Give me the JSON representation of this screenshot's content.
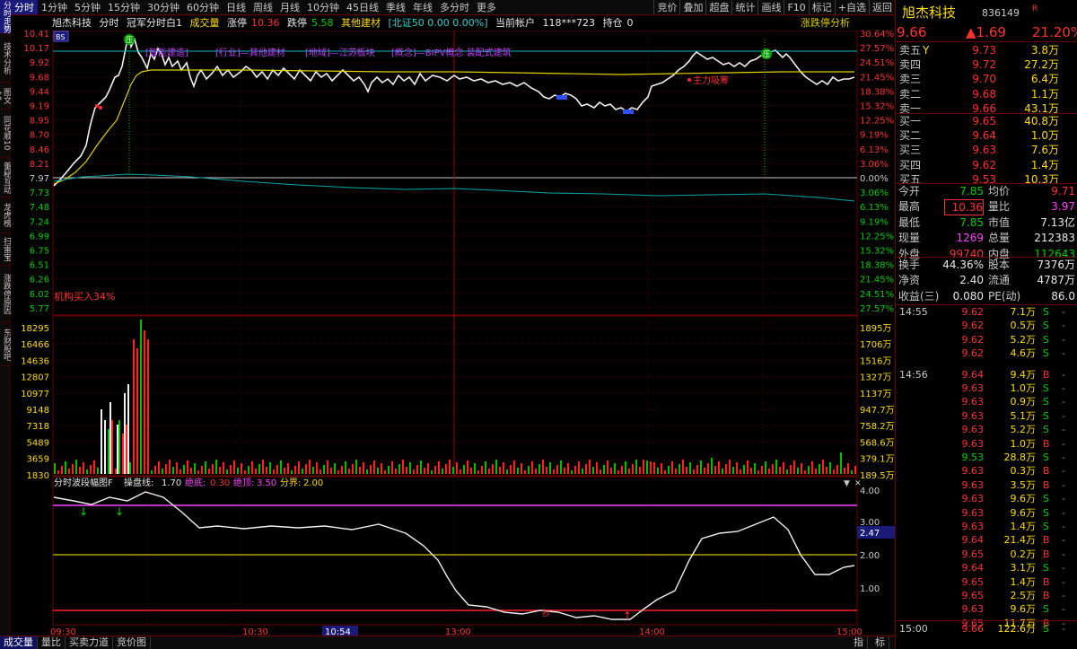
{
  "side_tabs": [
    "分时走势",
    "技术分析",
    "图文10",
    "同花顺10",
    "董秘互动",
    "龙虎榜",
    "扫雷宝",
    "涨跌停原因",
    "东财股吧"
  ],
  "timeframes": [
    "分时",
    "1分钟",
    "5分钟",
    "15分钟",
    "30分钟",
    "60分钟",
    "日线",
    "周线",
    "月线",
    "10分钟",
    "45日线",
    "季线",
    "年线",
    "多分时",
    "更多"
  ],
  "tools": [
    "竞价",
    "叠加",
    "超盘",
    "统计",
    "画线",
    "F10",
    "标记",
    "+自选",
    "返回"
  ],
  "info": {
    "name": "旭杰科技",
    "mode": "分时",
    "title": "冠军分时白1",
    "vol_label": "成交量",
    "up_label": "涨停",
    "up_value": "10.36",
    "down_label": "跌停",
    "down_value": "5.58",
    "sector": "其他建材",
    "index_text": "[北证50 0.00 0.00%]",
    "account": "当前帐户",
    "account_val": "118***723",
    "pos_label": "持仓",
    "pos_val": "0"
  },
  "zdtfx": "涨跌停分析",
  "price_axis": {
    "left": [
      "10.41",
      "10.17",
      "9.92",
      "9.68",
      "9.44",
      "9.19",
      "8.95",
      "8.70",
      "8.46",
      "8.21",
      "7.97",
      "7.73",
      "7.48",
      "7.24",
      "6.99",
      "6.75",
      "6.51",
      "6.26",
      "6.02",
      "5.77"
    ],
    "right": [
      "30.64%",
      "27.57%",
      "24.51%",
      "21.45%",
      "18.38%",
      "15.32%",
      "12.25%",
      "9.19%",
      "6.13%",
      "3.06%",
      "0.00%",
      "3.06%",
      "6.13%",
      "9.19%",
      "12.25%",
      "15.32%",
      "18.38%",
      "21.45%",
      "24.51%",
      "27.57%"
    ]
  },
  "vol_axis": {
    "left": [
      "18295",
      "16466",
      "14636",
      "12807",
      "10977",
      "9148",
      "7318",
      "5489",
      "3659",
      "1830"
    ],
    "right": [
      "1895万",
      "1706万",
      "1516万",
      "1327万",
      "1137万",
      "947.7万",
      "758.2万",
      "568.6万",
      "379.1万",
      "189.5万"
    ]
  },
  "ind_axis": {
    "right": [
      "4.00",
      "3.00",
      "2.00",
      "1.00"
    ],
    "current": "2.47"
  },
  "time_axis": [
    "09:30",
    "10:30",
    "10:54",
    "13:00",
    "14:00",
    "15:00"
  ],
  "tags": [
    "[智能建造]",
    "[行业]—其他建材",
    "[地域]—江苏板块",
    "[概念]—BIPV概念 装配式建筑"
  ],
  "annotations": {
    "main_force": "主力吸筹",
    "inst": "机构买入34%",
    "bs": "BS",
    "z_marks": [
      "压",
      "压"
    ]
  },
  "indicator": {
    "name": "分时波段幅图F",
    "lines": "操盘线:",
    "lines_val": "1.70",
    "bottom": "绝底:",
    "bottom_val": "0.30",
    "top": "绝顶:",
    "top_val": "3.50",
    "div": "分界:",
    "div_val": "2.00",
    "bottom_mark": "抄"
  },
  "bottom_tabs": [
    "成交量",
    "量比",
    "买卖力道",
    "竞价图"
  ],
  "bottom_right": [
    "指",
    "标"
  ],
  "quote": {
    "name": "旭杰科技",
    "code": "836149",
    "flag": "R",
    "price": "9.66",
    "change": "▲1.69",
    "pct": "21.20%"
  },
  "sells": [
    {
      "label": "卖五",
      "mark": "Y",
      "price": "9.73",
      "vol": "3.8万"
    },
    {
      "label": "卖四",
      "price": "9.72",
      "vol": "27.2万"
    },
    {
      "label": "卖三",
      "price": "9.70",
      "vol": "6.4万"
    },
    {
      "label": "卖二",
      "price": "9.68",
      "vol": "1.1万"
    },
    {
      "label": "卖一",
      "price": "9.66",
      "vol": "43.1万"
    }
  ],
  "buys": [
    {
      "label": "买一",
      "price": "9.65",
      "vol": "40.8万"
    },
    {
      "label": "买二",
      "price": "9.64",
      "vol": "1.0万"
    },
    {
      "label": "买三",
      "price": "9.63",
      "vol": "7.6万"
    },
    {
      "label": "买四",
      "price": "9.62",
      "vol": "1.4万"
    },
    {
      "label": "买五",
      "price": "9.53",
      "vol": "10.3万"
    }
  ],
  "stats": [
    {
      "l1": "今开",
      "v1": "7.85",
      "c1": "grn",
      "l2": "均价",
      "v2": "9.71",
      "c2": "red"
    },
    {
      "l1": "最高",
      "v1": "10.36",
      "c1": "red",
      "box1": true,
      "l2": "量比",
      "v2": "3.97",
      "c2": "mag"
    },
    {
      "l1": "最低",
      "v1": "7.85",
      "c1": "grn",
      "l2": "市值",
      "v2": "7.13亿",
      "c2": "wht"
    },
    {
      "l1": "现量",
      "v1": "1269",
      "c1": "mag",
      "l2": "总量",
      "v2": "212383",
      "c2": "wht"
    },
    {
      "l1": "外盘",
      "v1": "99740",
      "c1": "red",
      "l2": "内盘",
      "v2": "112643",
      "c2": "grn"
    }
  ],
  "stats2": [
    {
      "l1": "换手",
      "v1": "44.36%",
      "c1": "wht",
      "l2": "股本",
      "v2": "7376万",
      "c2": "wht"
    },
    {
      "l1": "净资",
      "v1": "2.40",
      "c1": "wht",
      "l2": "流通",
      "v2": "4787万",
      "c2": "wht"
    },
    {
      "l1": "收益(三)",
      "v1": "0.080",
      "c1": "wht",
      "l2": "PE(动)",
      "v2": "86.0",
      "c2": "wht"
    }
  ],
  "ticks": [
    {
      "t": "14:55",
      "p": "9.62",
      "v": "7.1万",
      "d": "S"
    },
    {
      "t": "",
      "p": "9.62",
      "v": "0.5万",
      "d": "S"
    },
    {
      "t": "",
      "p": "9.62",
      "v": "5.2万",
      "d": "S"
    },
    {
      "t": "",
      "p": "9.62",
      "v": "4.6万",
      "d": "S"
    },
    {
      "t": "14:56",
      "p": "9.64",
      "v": "9.4万",
      "d": "B"
    },
    {
      "t": "",
      "p": "9.63",
      "v": "1.0万",
      "d": "S"
    },
    {
      "t": "",
      "p": "9.63",
      "v": "0.9万",
      "d": "S"
    },
    {
      "t": "",
      "p": "9.63",
      "v": "5.1万",
      "d": "S"
    },
    {
      "t": "",
      "p": "9.63",
      "v": "5.2万",
      "d": "S"
    },
    {
      "t": "",
      "p": "9.63",
      "v": "1.0万",
      "d": "B"
    },
    {
      "t": "",
      "p": "9.53",
      "v": "28.8万",
      "d": "S"
    },
    {
      "t": "",
      "p": "9.63",
      "v": "0.3万",
      "d": "B"
    },
    {
      "t": "",
      "p": "9.63",
      "v": "3.5万",
      "d": "B"
    },
    {
      "t": "",
      "p": "9.63",
      "v": "9.6万",
      "d": "S"
    },
    {
      "t": "",
      "p": "9.63",
      "v": "9.6万",
      "d": "S"
    },
    {
      "t": "",
      "p": "9.63",
      "v": "1.4万",
      "d": "S"
    },
    {
      "t": "",
      "p": "9.64",
      "v": "21.4万",
      "d": "B"
    },
    {
      "t": "",
      "p": "9.65",
      "v": "0.2万",
      "d": "B"
    },
    {
      "t": "",
      "p": "9.64",
      "v": "3.1万",
      "d": "S"
    },
    {
      "t": "",
      "p": "9.65",
      "v": "1.4万",
      "d": "B"
    },
    {
      "t": "",
      "p": "9.65",
      "v": "2.5万",
      "d": "B"
    },
    {
      "t": "",
      "p": "9.63",
      "v": "9.6万",
      "d": "S"
    },
    {
      "t": "",
      "p": "9.65",
      "v": "11.7万",
      "d": "B"
    }
  ],
  "last_tick": {
    "t": "15:00",
    "p": "9.66",
    "v": "122.6万",
    "d": "S"
  },
  "colors": {
    "up": "#ff3030",
    "down": "#00d000",
    "grid": "#6a0000",
    "accent": "#ffdd00"
  }
}
